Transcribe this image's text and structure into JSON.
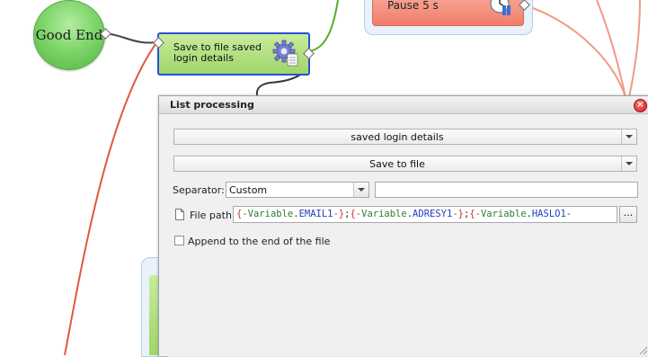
{
  "canvas": {
    "good_end_label": "Good End",
    "save_node_label": "Save to file saved login details",
    "pause_node_label": "Pause 5 s",
    "gear_icon": "gear-icon",
    "pause_icon": "clock-icon"
  },
  "dialog": {
    "title": "List processing",
    "close_icon": "close-icon",
    "list_select": "saved login details",
    "action_select": "Save to file",
    "separator_label": "Separator:",
    "separator_select": "Custom",
    "separator_value": "",
    "file_path_label": "File path",
    "file_path_icon": "file-icon",
    "file_path_value": "{-Variable.EMAIL1-};{-Variable.ADRESY1-};{-Variable.HASLO1-",
    "browse_label": "...",
    "append_label": "Append to the end of the file",
    "append_checked": false
  },
  "colors": {
    "node_green": "#9fd56a",
    "node_red": "#ef7e6a",
    "selection_border": "#2b4fd6",
    "dialog_bg": "#f0f0f0"
  }
}
